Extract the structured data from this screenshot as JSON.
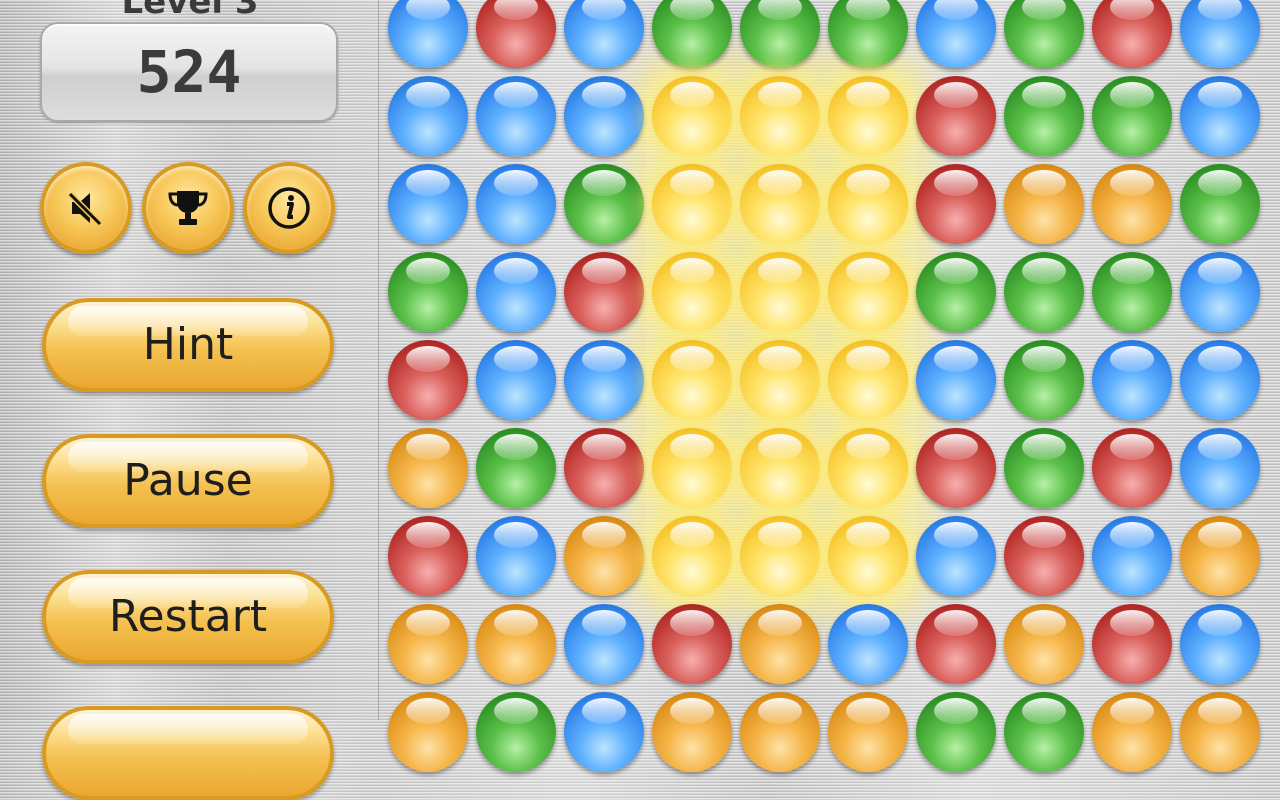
{
  "header": {
    "level_label": "Level 3",
    "score": "524"
  },
  "icon_buttons": [
    {
      "name": "sound-mute-icon"
    },
    {
      "name": "trophy-icon"
    },
    {
      "name": "info-icon"
    }
  ],
  "menu": {
    "hint_label": "Hint",
    "pause_label": "Pause",
    "restart_label": "Restart"
  },
  "colors": {
    "blue": "#2c80e8",
    "red": "#b52b28",
    "green": "#2f9426",
    "orange": "#dd8f1a",
    "yellow_selected": "#f7c52b",
    "button_gold": "#f4c150"
  },
  "board": {
    "columns": 10,
    "selected_color": "yellow",
    "rows": [
      [
        "blue",
        "red",
        "blue",
        "green",
        "green",
        "green",
        "blue",
        "green",
        "red",
        "blue"
      ],
      [
        "blue",
        "blue",
        "blue",
        "yellow",
        "yellow",
        "yellow",
        "red",
        "green",
        "green",
        "blue"
      ],
      [
        "blue",
        "blue",
        "green",
        "yellow",
        "yellow",
        "yellow",
        "red",
        "orange",
        "orange",
        "green"
      ],
      [
        "green",
        "blue",
        "red",
        "yellow",
        "yellow",
        "yellow",
        "green",
        "green",
        "green",
        "blue"
      ],
      [
        "red",
        "blue",
        "blue",
        "yellow",
        "yellow",
        "yellow",
        "blue",
        "green",
        "blue",
        "blue"
      ],
      [
        "orange",
        "green",
        "red",
        "yellow",
        "yellow",
        "yellow",
        "red",
        "green",
        "red",
        "blue"
      ],
      [
        "red",
        "blue",
        "orange",
        "yellow",
        "yellow",
        "yellow",
        "blue",
        "red",
        "blue",
        "orange"
      ],
      [
        "orange",
        "orange",
        "blue",
        "red",
        "orange",
        "blue",
        "red",
        "orange",
        "red",
        "blue"
      ],
      [
        "orange",
        "green",
        "blue",
        "orange",
        "orange",
        "orange",
        "green",
        "green",
        "orange",
        "orange"
      ]
    ]
  }
}
